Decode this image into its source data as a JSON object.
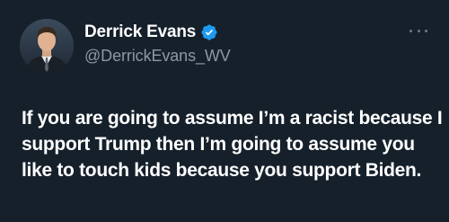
{
  "author": {
    "display_name": "Derrick Evans",
    "handle": "@DerrickEvans_WV",
    "verified": true,
    "avatar_icon": "profile-photo"
  },
  "tweet": {
    "text": "If you are going to assume I’m a racist because I support Trump then I’m going to assume you like to touch kids because you support Biden."
  },
  "menu": {
    "icon": "more-icon"
  },
  "colors": {
    "background": "#15202b",
    "text": "#ffffff",
    "secondary_text": "#8b98a5",
    "verified_badge": "#1d9bf0"
  }
}
